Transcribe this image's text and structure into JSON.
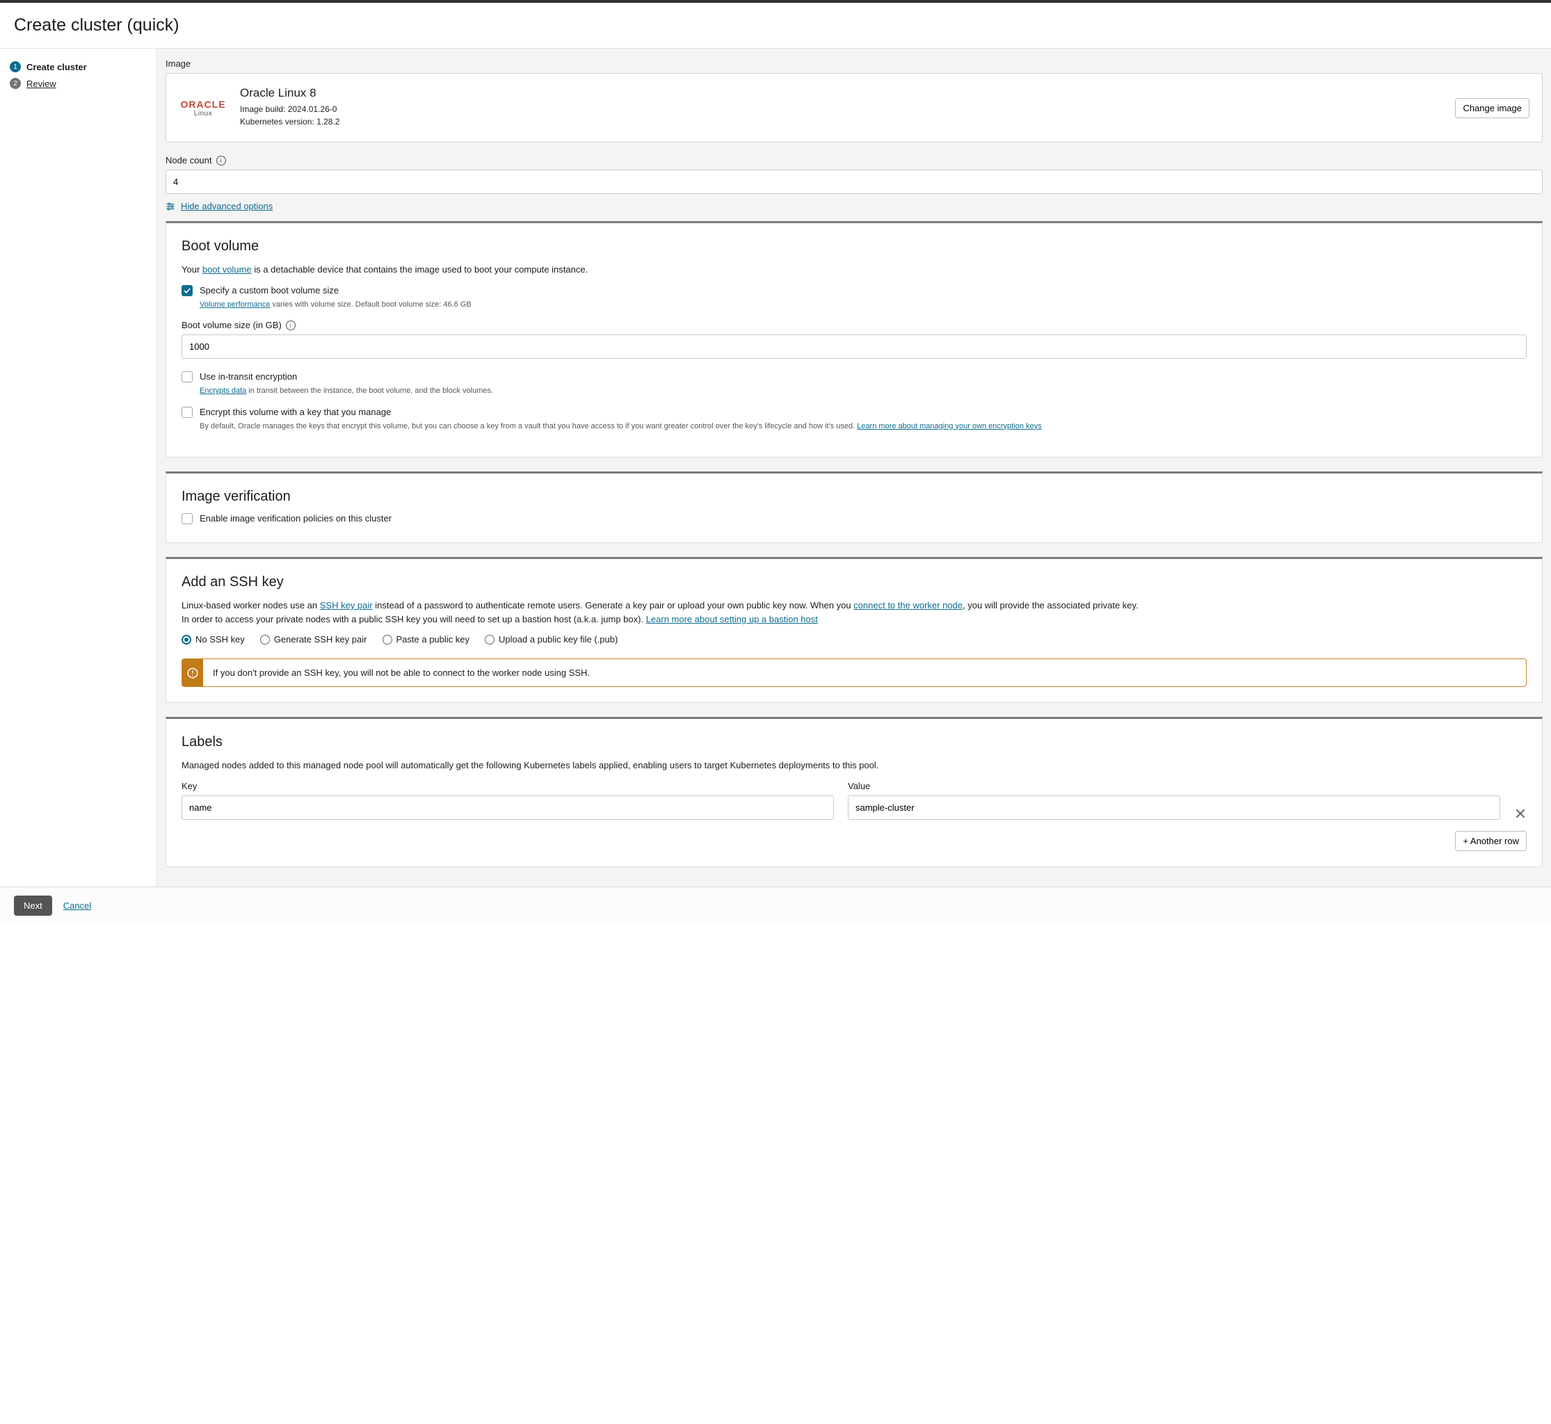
{
  "page": {
    "title": "Create cluster (quick)"
  },
  "steps": [
    {
      "num": "1",
      "label": "Create cluster",
      "active": true
    },
    {
      "num": "2",
      "label": "Review",
      "active": false
    }
  ],
  "image": {
    "section_label": "Image",
    "logo_top": "ORACLE",
    "logo_bottom": "Linux",
    "name": "Oracle Linux 8",
    "build_label": "Image build: 2024.01.26-0",
    "k8s_label": "Kubernetes version: 1.28.2",
    "change_btn": "Change image"
  },
  "nodecount": {
    "label": "Node count",
    "value": "4"
  },
  "advanced": {
    "toggle_label": "Hide advanced options"
  },
  "bootvolume": {
    "heading": "Boot volume",
    "desc_prefix": "Your ",
    "desc_link": "boot volume",
    "desc_suffix": " is a detachable device that contains the image used to boot your compute instance.",
    "custom_size_label": "Specify a custom boot volume size",
    "custom_size_help_link": "Volume performance",
    "custom_size_help_rest": " varies with volume size. Default boot volume size: 46.6 GB",
    "size_label": "Boot volume size (in GB)",
    "size_value": "1000",
    "transit_label": "Use in-transit encryption",
    "transit_help_link": "Encrypts data",
    "transit_help_rest": " in transit between the instance, the boot volume, and the block volumes.",
    "managekey_label": "Encrypt this volume with a key that you manage",
    "managekey_help_prefix": "By default, Oracle manages the keys that encrypt this volume, but you can choose a key from a vault that you have access to if you want greater control over the key's lifecycle and how it's used. ",
    "managekey_help_link": "Learn more about managing your own encryption keys"
  },
  "imagever": {
    "heading": "Image verification",
    "enable_label": "Enable image verification policies on this cluster"
  },
  "ssh": {
    "heading": "Add an SSH key",
    "p1_prefix": "Linux-based worker nodes use an ",
    "p1_link1": "SSH key pair",
    "p1_mid": " instead of a password to authenticate remote users. Generate a key pair or upload your own public key now. When you ",
    "p1_link2": "connect to the worker node",
    "p1_suffix": ", you will provide the associated private key.",
    "p2_prefix": "In order to access your private nodes with a public SSH key you will need to set up a bastion host (a.k.a. jump box). ",
    "p2_link": "Learn more about setting up a bastion host",
    "options": {
      "no": "No SSH key",
      "gen": "Generate SSH key pair",
      "paste": "Paste a public key",
      "upload": "Upload a public key file (.pub)"
    },
    "warn": "If you don't provide an SSH key, you will not be able to connect to the worker node using SSH."
  },
  "labels": {
    "heading": "Labels",
    "desc": "Managed nodes added to this managed node pool will automatically get the following Kubernetes labels applied, enabling users to target Kubernetes deployments to this pool.",
    "key_label": "Key",
    "value_label": "Value",
    "key_value": "name",
    "val_value": "sample-cluster",
    "add_btn": "+ Another row"
  },
  "footer": {
    "next": "Next",
    "cancel": "Cancel"
  }
}
